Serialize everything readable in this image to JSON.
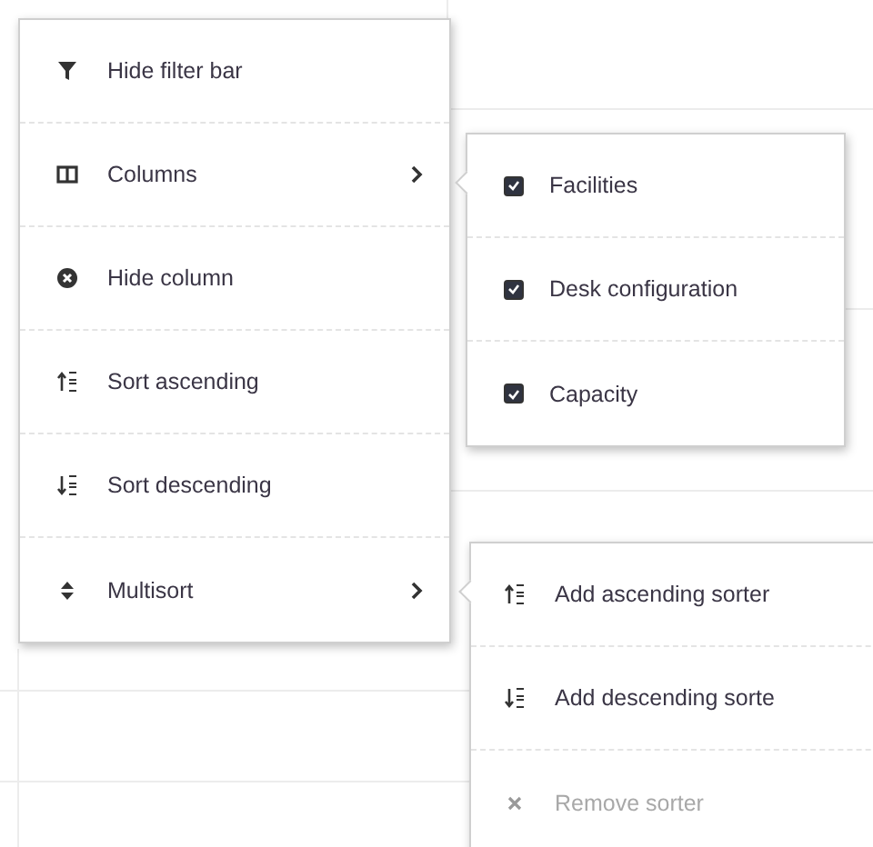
{
  "menu": {
    "items": [
      {
        "label": "Hide filter bar",
        "has_submenu": false
      },
      {
        "label": "Columns",
        "has_submenu": true
      },
      {
        "label": "Hide column",
        "has_submenu": false
      },
      {
        "label": "Sort ascending",
        "has_submenu": false
      },
      {
        "label": "Sort descending",
        "has_submenu": false
      },
      {
        "label": "Multisort",
        "has_submenu": true
      }
    ]
  },
  "columns_submenu": {
    "items": [
      {
        "label": "Facilities",
        "checked": true
      },
      {
        "label": "Desk configuration",
        "checked": true
      },
      {
        "label": "Capacity",
        "checked": true
      }
    ]
  },
  "multisort_submenu": {
    "items": [
      {
        "label": "Add ascending sorter",
        "disabled": false
      },
      {
        "label": "Add descending sorte",
        "disabled": false
      },
      {
        "label": "Remove sorter",
        "disabled": true
      }
    ]
  }
}
